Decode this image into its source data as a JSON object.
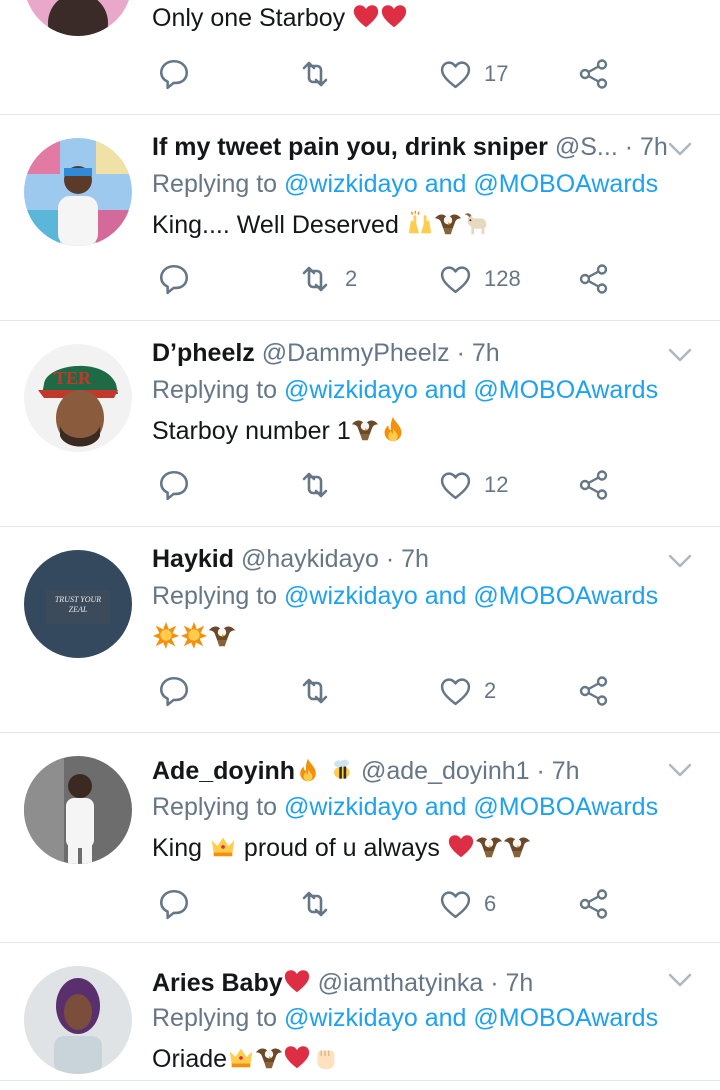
{
  "colors": {
    "link": "#1da1f2",
    "gray": "#657786",
    "text": "#14171a",
    "divider": "#e1e8ed",
    "heart": "#e0245e"
  },
  "icons": [
    "reply-icon",
    "retweet-icon",
    "like-icon",
    "share-icon",
    "chevron-down-icon"
  ],
  "top_tweet": {
    "text": "Only one Starboy",
    "emoji": [
      "red-heart",
      "red-heart"
    ],
    "likes": "17"
  },
  "tweets": [
    {
      "name": "If my tweet pain you, drink sniper",
      "handle": "@S...",
      "sep": " · ",
      "time": "7h",
      "reply_prefix": "Replying to ",
      "reply_to": "@wizkidayo and @MOBOAwards",
      "text": "King.... Well Deserved ",
      "emoji": [
        "raised-hands",
        "eagle",
        "goat"
      ],
      "retweets": "2",
      "likes": "128"
    },
    {
      "name": "D’pheelz",
      "handle": "@DammyPheelz",
      "sep": " · ",
      "time": "7h",
      "reply_prefix": "Replying to ",
      "reply_to": "@wizkidayo and @MOBOAwards",
      "text": "Starboy number 1",
      "emoji": [
        "eagle",
        "fire"
      ],
      "retweets": "",
      "likes": "12"
    },
    {
      "name": "Haykid",
      "handle": "@haykidayo",
      "sep": " · ",
      "time": "7h",
      "reply_prefix": "Replying to ",
      "reply_to": "@wizkidayo and @MOBOAwards",
      "text": "",
      "emoji": [
        "collision",
        "collision",
        "eagle"
      ],
      "retweets": "",
      "likes": "2",
      "avatar_text": [
        "TRUST YOUR",
        "ZEAL"
      ]
    },
    {
      "name": "Ade_doyinh",
      "handle": "@ade_doyinh1",
      "sep": " · ",
      "time": "7h",
      "reply_prefix": "Replying to ",
      "reply_to": "@wizkidayo and @MOBOAwards",
      "text": "King ",
      "text2": " proud of u always ",
      "emoji": [
        "crown",
        "red-heart",
        "eagle",
        "eagle"
      ],
      "name_emoji": [
        "fire",
        "bee"
      ],
      "retweets": "",
      "likes": "6"
    },
    {
      "name": "Aries Baby",
      "handle": "@iamthatyinka",
      "sep": " · ",
      "time": "7h",
      "reply_prefix": "Replying to ",
      "reply_to": "@wizkidayo and @MOBOAwards",
      "text": "Oriade",
      "emoji": [
        "crown",
        "eagle",
        "red-heart",
        "raised-fist"
      ],
      "name_emoji": [
        "red-heart"
      ],
      "retweets": "",
      "likes": ""
    }
  ]
}
